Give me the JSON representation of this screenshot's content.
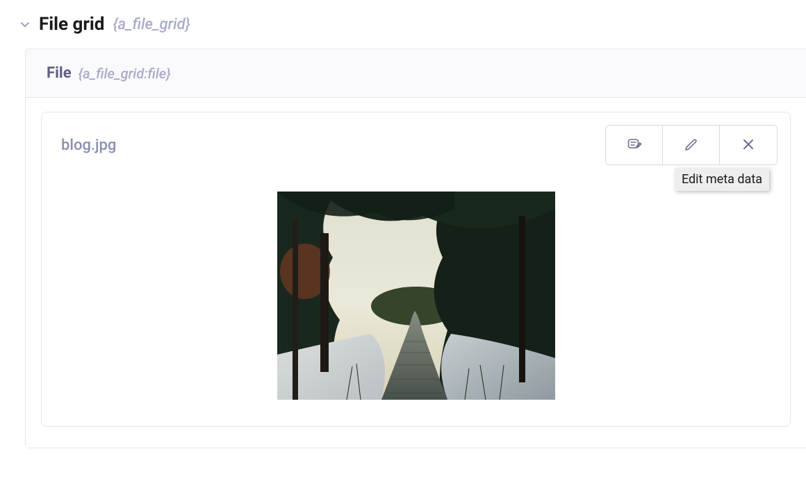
{
  "header": {
    "title": "File grid",
    "tag": "{a_file_grid}"
  },
  "panel": {
    "title": "File",
    "tag": "{a_file_grid:file}"
  },
  "file": {
    "name": "blog.jpg"
  },
  "tooltip": {
    "text": "Edit meta data"
  },
  "icons": {
    "note": "note-icon",
    "edit": "pencil-icon",
    "remove": "close-icon",
    "chevron": "chevron-down-icon"
  }
}
